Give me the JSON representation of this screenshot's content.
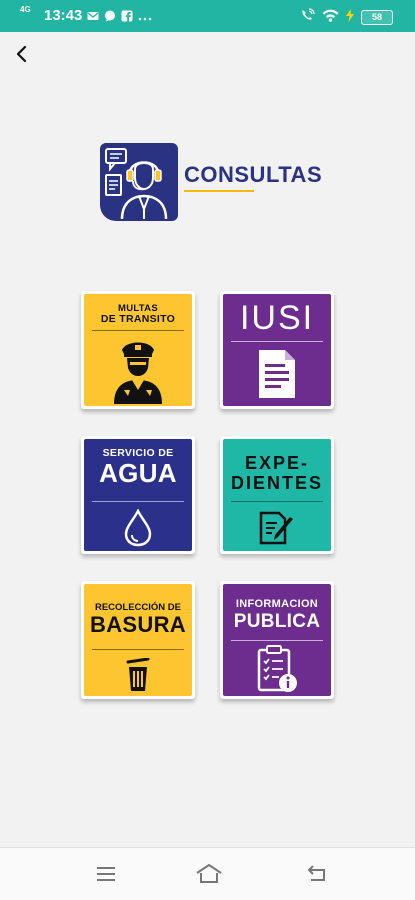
{
  "status_bar": {
    "signal": "4G",
    "time": "13:43",
    "battery": "58"
  },
  "header": {
    "title": "CONSULTAS"
  },
  "tiles": [
    {
      "line1": "MULTAS",
      "line2": "DE TRANSITO",
      "color": "#fdc530",
      "text_color": "#111111"
    },
    {
      "line1": "IUSI",
      "color": "#6c2d8f",
      "text_color": "#ffffff"
    },
    {
      "line1": "SERVICIO DE",
      "line2": "AGUA",
      "color": "#2b318a",
      "text_color": "#ffffff"
    },
    {
      "line1": "EXPE-",
      "line2": "DIENTES",
      "color": "#1fb7a6",
      "text_color": "#111111"
    },
    {
      "line1": "RECOLECCIÓN DE",
      "line2": "BASURA",
      "color": "#fdc530",
      "text_color": "#111111"
    },
    {
      "line1": "INFORMACION",
      "line2": "PUBLICA",
      "color": "#6c2d8f",
      "text_color": "#ffffff"
    }
  ],
  "colors": {
    "teal": "#22b5a3",
    "navy": "#2a3382",
    "yellow": "#fdc530",
    "purple": "#6c2d8f"
  }
}
